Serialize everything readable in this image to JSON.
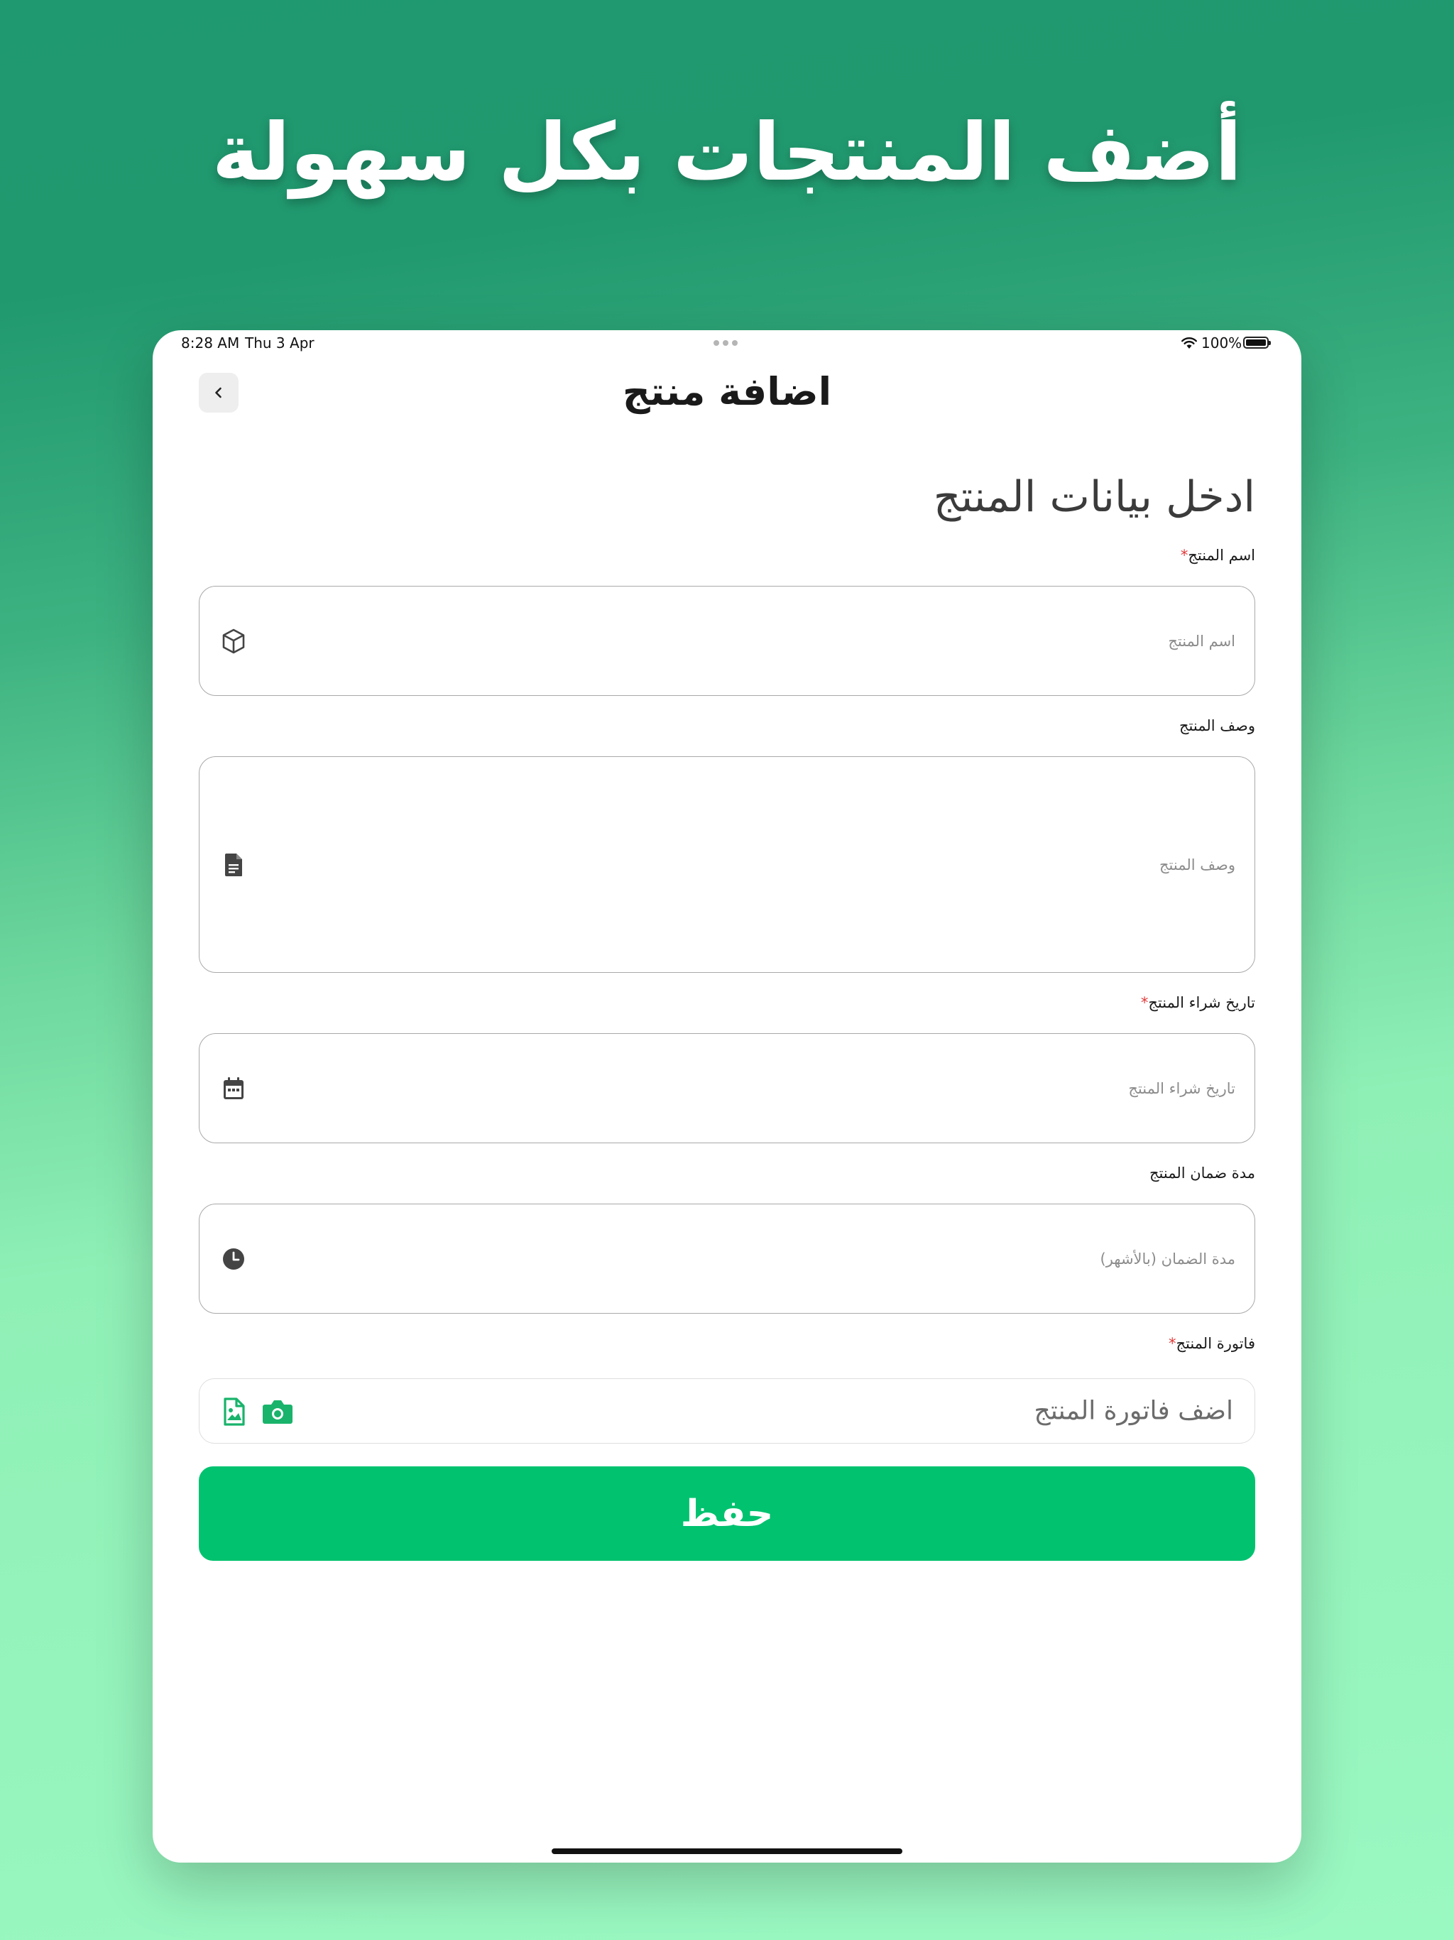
{
  "headline": "أضف المنتجات بكل سهولة",
  "status_bar": {
    "time": "8:28 AM",
    "date": "Thu 3 Apr",
    "battery": "100%"
  },
  "nav": {
    "title": "اضافة منتج",
    "back_icon": "chevron-left-icon"
  },
  "form": {
    "heading": "ادخل بيانات المنتج",
    "fields": [
      {
        "label": "اسم المنتج",
        "required": true,
        "placeholder": "اسم المنتج",
        "icon": "box-icon"
      },
      {
        "label": "وصف المنتج",
        "required": false,
        "placeholder": "وصف المنتج",
        "icon": "document-icon"
      },
      {
        "label": "تاريخ شراء المنتج",
        "required": true,
        "placeholder": "تاريخ شراء المنتج",
        "icon": "calendar-icon"
      },
      {
        "label": "مدة ضمان المنتج",
        "required": false,
        "placeholder": "مدة الضمان (بالأشهر)",
        "icon": "clock-icon"
      }
    ],
    "invoice": {
      "label": "فاتورة المنتج",
      "required": true,
      "placeholder": "اضف فاتورة المنتج",
      "icons": [
        "image-file-icon",
        "camera-icon"
      ]
    },
    "save_label": "حفظ"
  },
  "colors": {
    "accent": "#00c26f",
    "required": "#e23b3b",
    "background_top": "#1f9970",
    "background_bottom": "#9af8c1"
  }
}
